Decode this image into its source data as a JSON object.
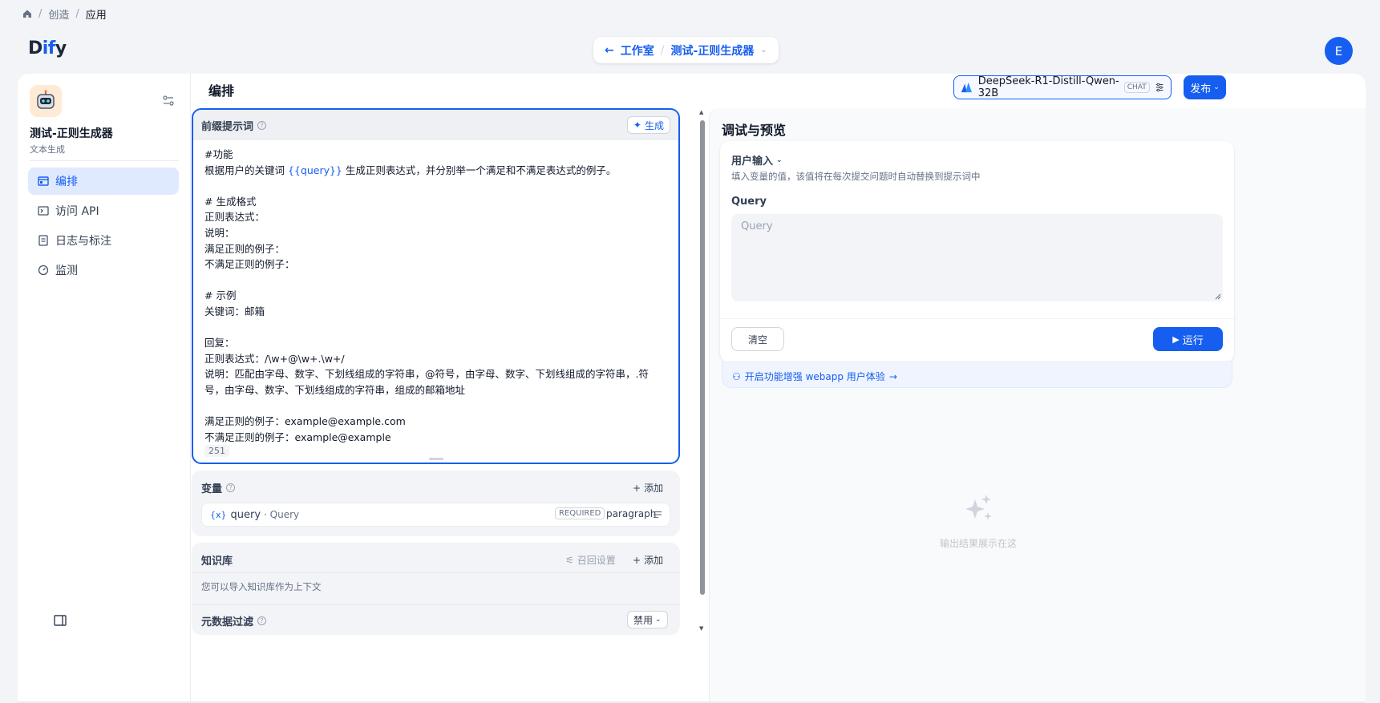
{
  "breadcrumb": {
    "items": [
      "创造",
      "应用"
    ]
  },
  "appbar": {
    "logo_prefix": "D",
    "logo_mid": "if",
    "logo_suffix": "y",
    "back_label": "工作室",
    "app_switch_label": "测试-正则生成器",
    "user_initial": "E"
  },
  "sidebar": {
    "app_name": "测试-正则生成器",
    "app_type": "文本生成",
    "items": [
      {
        "label": "编排",
        "icon": "layout-icon",
        "active": true
      },
      {
        "label": "访问 API",
        "icon": "terminal-icon",
        "active": false
      },
      {
        "label": "日志与标注",
        "icon": "file-list-icon",
        "active": false
      },
      {
        "label": "监测",
        "icon": "dashboard-icon",
        "active": false
      }
    ]
  },
  "orchestrate": {
    "title": "编排",
    "model_name": "DeepSeek-R1-Distill-Qwen-32B",
    "model_mode": "CHAT",
    "publish_label": "发布"
  },
  "prompt": {
    "label": "前缀提示词",
    "generate_label": "生成",
    "line1": "#功能",
    "line2_before": "根据用户的关键词 ",
    "line2_var": "{{query}}",
    "line2_after": " 生成正则表达式，并分别举一个满足和不满足表达式的例子。",
    "rest": "\n# 生成格式\n正则表达式：\n说明：\n满足正则的例子：\n不满足正则的例子：\n\n# 示例\n关键词：邮箱\n\n回复：\n正则表达式：/\\w+@\\w+.\\w+/\n说明：匹配由字母、数字、下划线组成的字符串，@符号，由字母、数字、下划线组成的字符串，.符号，由字母、数字、下划线组成的字符串，组成的邮箱地址\n\n满足正则的例子：example@example.com\n不满足正则的例子：example@example",
    "char_count": "251"
  },
  "variables": {
    "title": "变量",
    "add_label": "添加",
    "rows": [
      {
        "brace": "{x}",
        "key": "query",
        "label": "· Query",
        "required": "REQUIRED",
        "type": "paragraph"
      }
    ]
  },
  "knowledge": {
    "title": "知识库",
    "recall_label": "召回设置",
    "add_label": "添加",
    "description": "您可以导入知识库作为上下文",
    "metadata_title": "元数据过滤",
    "metadata_value": "禁用"
  },
  "debug": {
    "title": "调试与预览",
    "user_input_label": "用户输入",
    "user_input_desc": "填入变量的值，该值将在每次提交问题时自动替换到提示词中",
    "query_label": "Query",
    "query_placeholder": "Query",
    "query_value": "",
    "clear_label": "清空",
    "run_label": "运行",
    "webapp_link": "开启功能增强 webapp 用户体验",
    "empty_text": "输出结果展示在这"
  },
  "colors": {
    "accent": "#155eef",
    "app_icon_bg": "#ffead5"
  }
}
